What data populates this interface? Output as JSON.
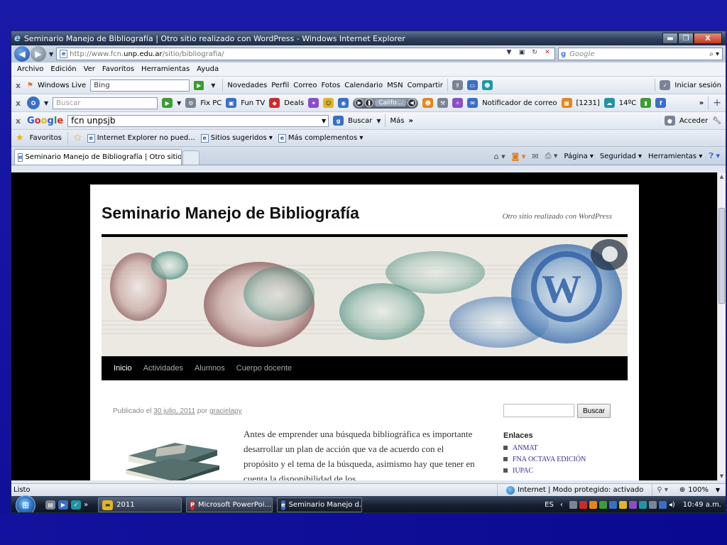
{
  "window": {
    "title": "Seminario Manejo de Bibliografía | Otro sitio realizado con WordPress - Windows Internet Explorer",
    "minimize_glyph": "▬",
    "maximize_glyph": "❐",
    "close_glyph": "X"
  },
  "address": {
    "url_prefix": "http://www.fcn.",
    "url_host": "unp.edu.ar",
    "url_path": "/sitio/bibliografia/",
    "search_placeholder": "Google"
  },
  "menu": [
    "Archivo",
    "Edición",
    "Ver",
    "Favoritos",
    "Herramientas",
    "Ayuda"
  ],
  "windows_live_bar": {
    "brand": "Windows Live",
    "search_value": "Bing",
    "links": [
      "Novedades",
      "Perfil",
      "Correo",
      "Fotos",
      "Calendario",
      "MSN",
      "Compartir"
    ],
    "signin": "Iniciar sesión"
  },
  "ask_bar": {
    "search_placeholder": "Buscar",
    "fix_pc": "Fix PC",
    "fun_tv": "Fun TV",
    "deals": "Deals",
    "radio_station": "Califo...",
    "mail_notifier": "Notificador de correo",
    "mail_count": "[1231]",
    "temperature": "14ºC",
    "overflow": "»"
  },
  "google_bar": {
    "query": "fcn unpsjb",
    "search_button": "Buscar",
    "more": "Más",
    "signin": "Acceder"
  },
  "favorites_bar": {
    "favorites": "Favoritos",
    "items": [
      "Internet Explorer no pued...",
      "Sitios sugeridos",
      "Más complementos"
    ]
  },
  "tab": {
    "label": "Seminario Manejo de Bibliografía | Otro sitio reali..."
  },
  "command_bar": {
    "page": "Página",
    "safety": "Seguridad",
    "tools": "Herramientas"
  },
  "site": {
    "title": "Seminario Manejo de Bibliografía",
    "description": "Otro sitio realizado con WordPress",
    "nav": [
      "Inicio",
      "Actividades",
      "Alumnos",
      "Cuerpo docente"
    ],
    "post_meta": {
      "prefix": "Publicado el",
      "date": "30 julio, 2011",
      "by": "por",
      "author": "gracielapy"
    },
    "entry_text": "Antes de emprender una búsqueda bibliográfica es importante desarrollar un plan de acción que va de acuerdo con el propósito y el tema de la búsqueda, asimismo hay que tener en cuenta la disponibilidad de los",
    "search_button": "Buscar",
    "links_title": "Enlaces",
    "links": [
      "ANMAT",
      "FNA OCTAVA EDICIÓN",
      "IUPAC"
    ]
  },
  "status": {
    "text": "Listo",
    "zone": "Internet | Modo protegido: activado",
    "zoom": "100%"
  },
  "taskbar": {
    "tasks": [
      "2011",
      "Microsoft PowerPoi...",
      "Seminario Manejo d..."
    ],
    "language": "ES",
    "clock": "10:49 a.m.",
    "overflow": "»"
  },
  "colors": {
    "desktop_blue": "#1414a0",
    "link_purple": "#3a2b8a",
    "menu_black": "#000000"
  }
}
